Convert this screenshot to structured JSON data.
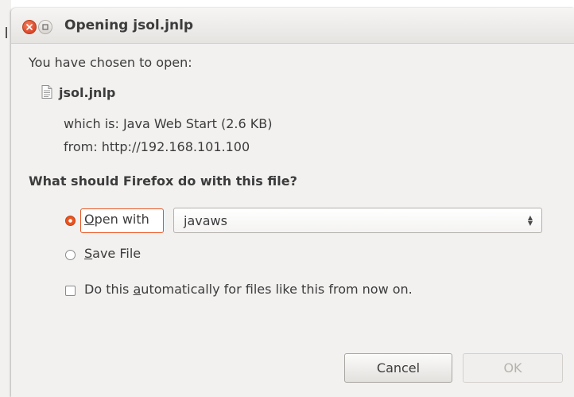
{
  "window": {
    "title": "Opening jsol.jnlp"
  },
  "dialog": {
    "intro": "You have chosen to open:",
    "file_name": "jsol.jnlp",
    "file_icon": "document-icon",
    "which_is": "which is:  Java Web Start (2.6 KB)",
    "from": "from:  http://192.168.101.100",
    "question": "What should Firefox do with this file?",
    "open_with": {
      "mnemonic": "O",
      "rest": "pen with",
      "selected": true
    },
    "application": {
      "value": "javaws"
    },
    "save_file": {
      "mnemonic": "S",
      "rest": "ave File",
      "selected": false
    },
    "auto": {
      "before": "Do this ",
      "mnemonic": "a",
      "after": "utomatically for files like this from now on.",
      "checked": false
    },
    "buttons": {
      "cancel": "Cancel",
      "ok": "OK"
    }
  },
  "colors": {
    "accent": "#e95420",
    "text": "#3c3c3c",
    "disabled_text": "#b6b3ae",
    "background": "#f2f1f0"
  }
}
